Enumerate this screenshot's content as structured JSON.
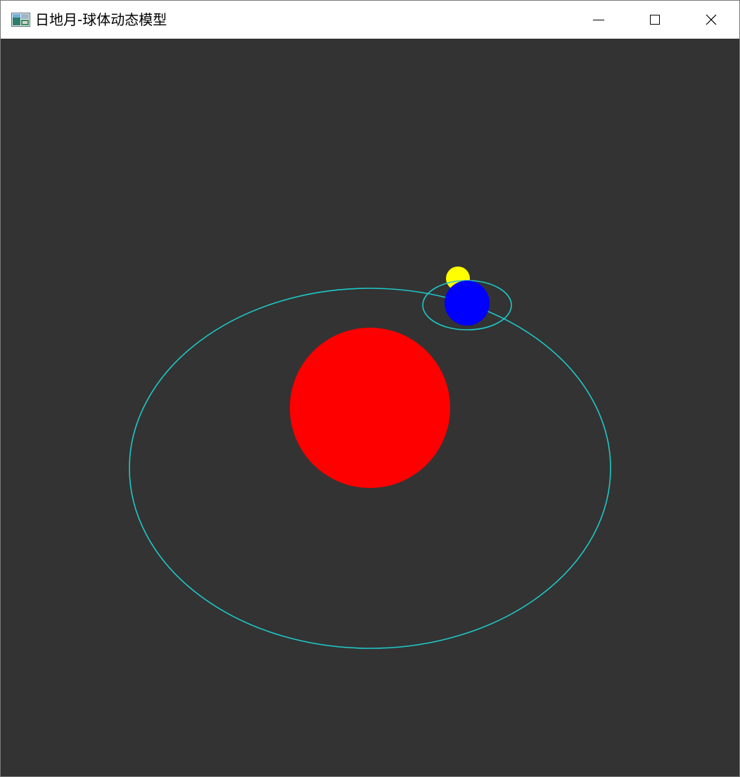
{
  "window": {
    "title": "日地月-球体动态模型"
  },
  "icons": {
    "app": "app-window-icon",
    "minimize": "minimize-icon",
    "maximize": "maximize-icon",
    "close": "close-icon"
  },
  "colors": {
    "canvas_background": "#333333",
    "sun": "#ff0000",
    "earth": "#0000ff",
    "moon": "#ffff00",
    "orbit": "#1ec8c8"
  },
  "scene": {
    "bodies": [
      "sun",
      "earth",
      "moon"
    ]
  }
}
